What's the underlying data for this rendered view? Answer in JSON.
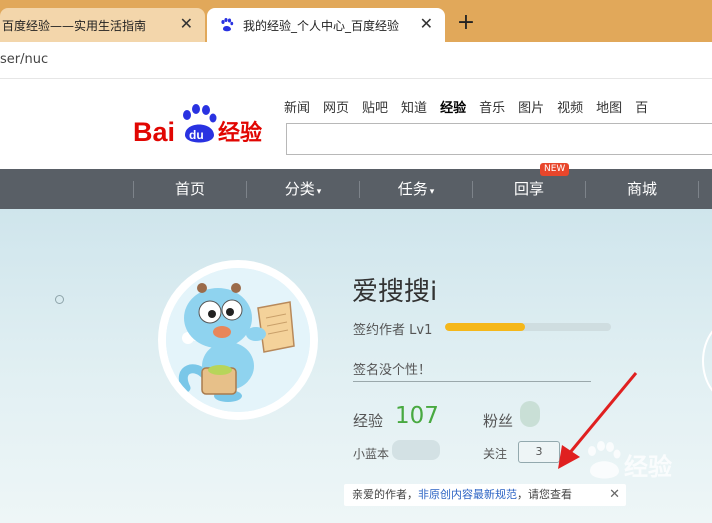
{
  "browser": {
    "tabs": [
      {
        "title": "百度经验——实用生活指南",
        "active": false
      },
      {
        "title": "我的经验_个人中心_百度经验",
        "active": true
      }
    ],
    "close_glyph": "✕",
    "newtab_glyph": "+",
    "address": "ser/nuc"
  },
  "header": {
    "logo_text": "Bai du 经验",
    "topnav": [
      "新闻",
      "网页",
      "贴吧",
      "知道",
      "经验",
      "音乐",
      "图片",
      "视频",
      "地图",
      "百"
    ],
    "topnav_active": "经验"
  },
  "mainnav": {
    "items": [
      "首页",
      "分类",
      "任务",
      "回享",
      "商城"
    ],
    "new_badge": "NEW"
  },
  "profile": {
    "username": "爱搜搜i",
    "level_label": "签约作者 Lv1",
    "level_progress": 0.48,
    "signature": "签名没个性！",
    "exp_label": "经验",
    "exp_value": "107",
    "fans_label": "粉丝",
    "blue_label": "小蓝本",
    "follow_label": "关注",
    "follow_value": "3",
    "notice_prefix": "亲爱的作者，",
    "notice_link": "非原创内容最新规范",
    "notice_suffix": "，请您查看",
    "notice_close": "✕"
  },
  "colors": {
    "tabbar": "#e1a85a",
    "nav_bg": "#595f66",
    "progress": "#f5b71a",
    "exp_green": "#48a940",
    "baidu_red": "#e10602",
    "baidu_blue": "#2932e1"
  }
}
